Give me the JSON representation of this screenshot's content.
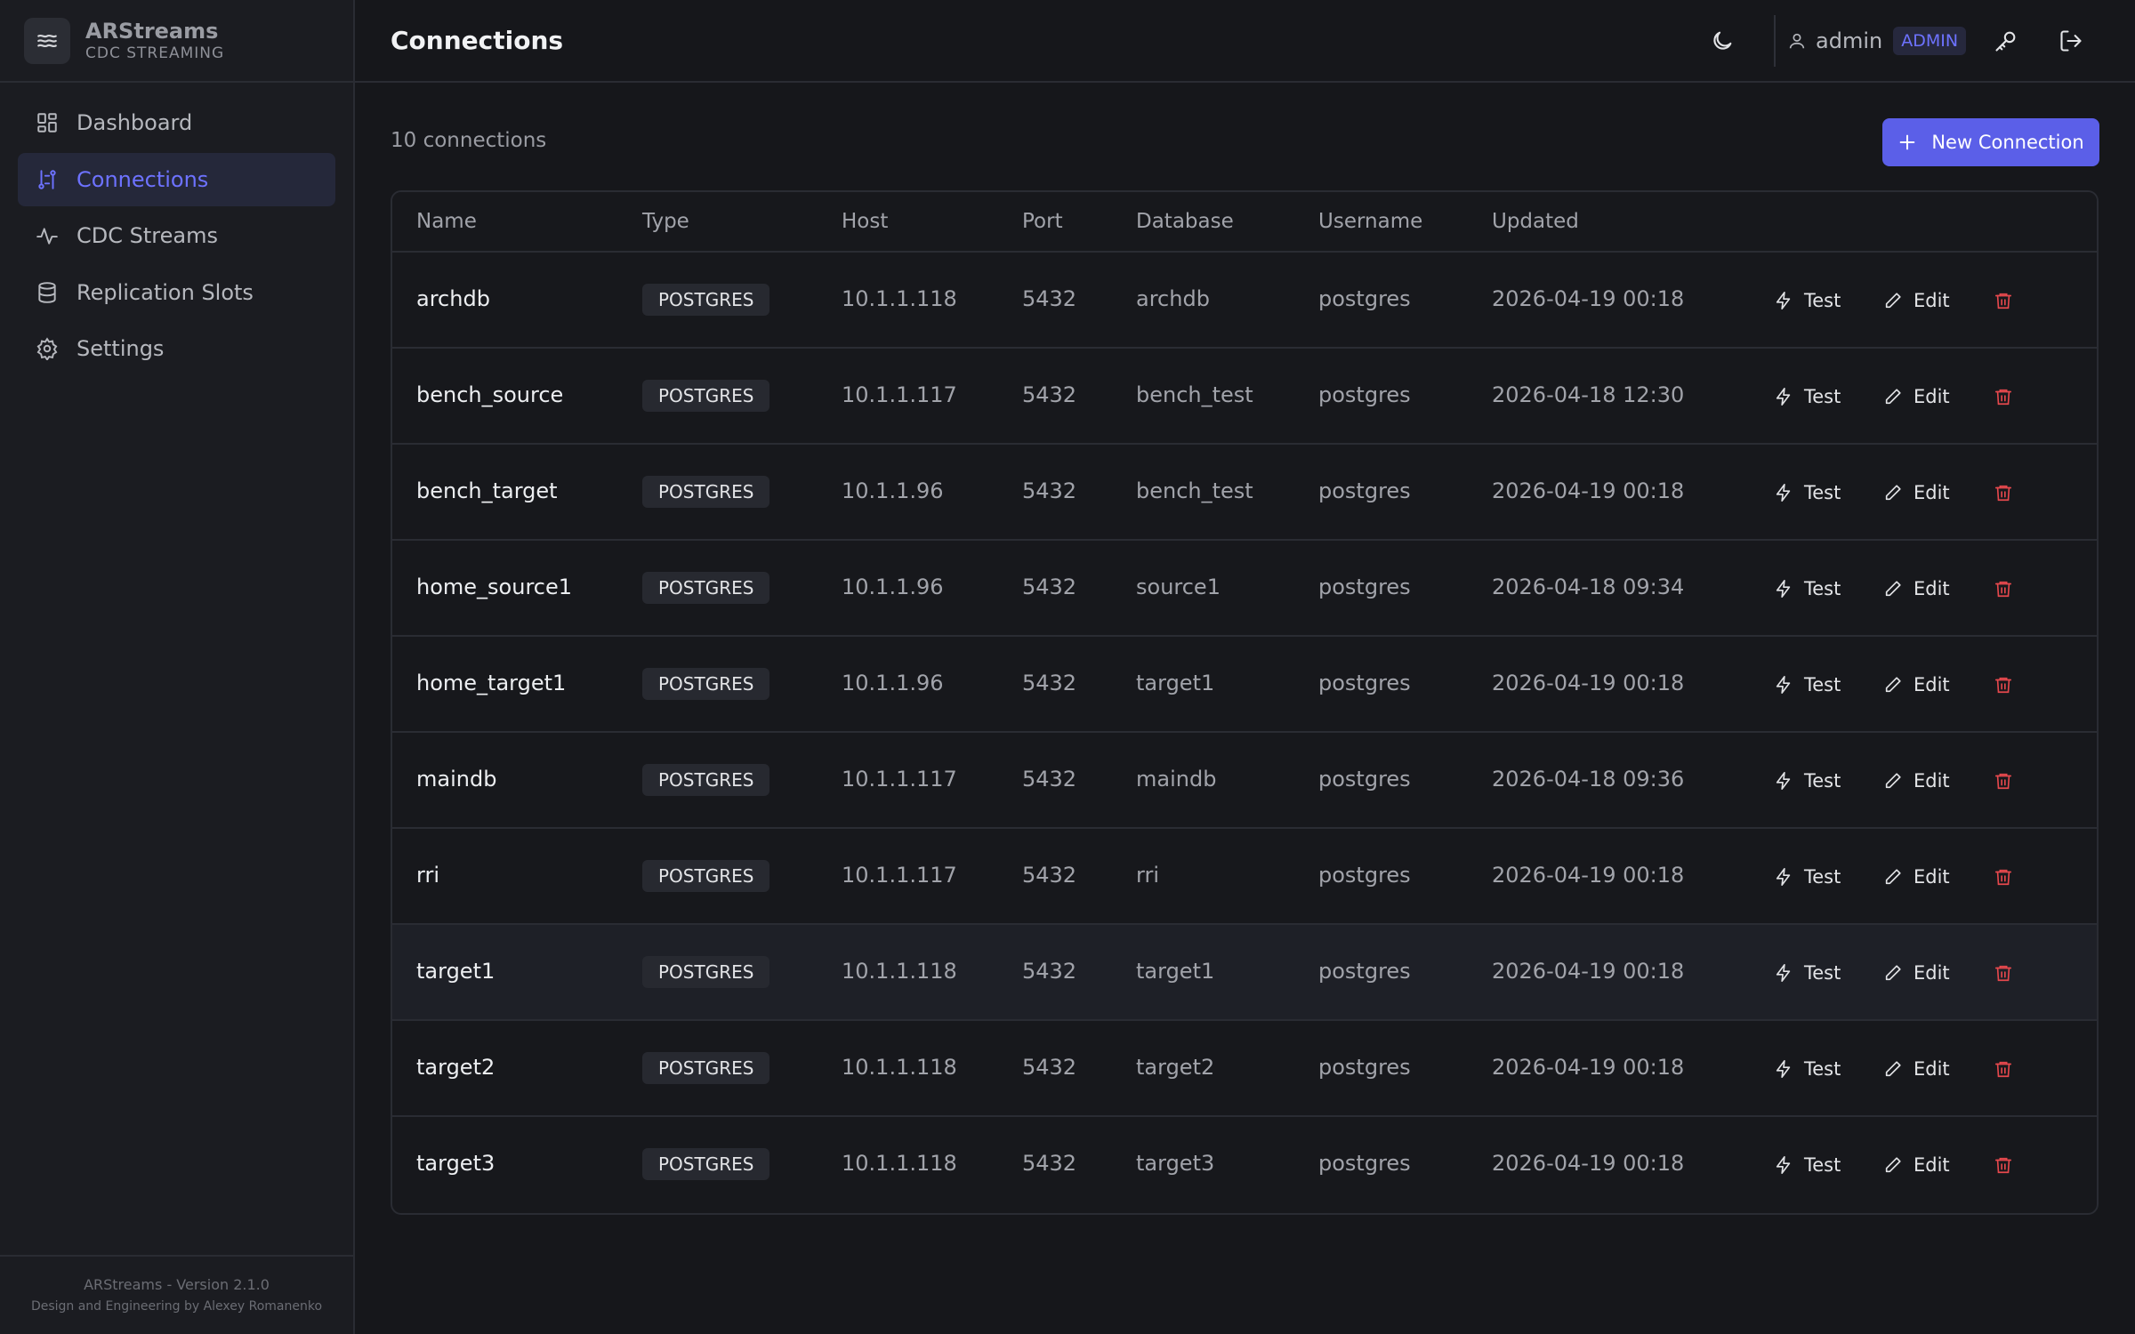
{
  "app": {
    "name": "ARStreams",
    "subtitle": "CDC STREAMING",
    "version_text": "ARStreams - Version 2.1.0",
    "credit_text": "Design and Engineering by Alexey Romanenko"
  },
  "nav": {
    "items": [
      {
        "label": "Dashboard",
        "icon": "grid-icon",
        "active": false
      },
      {
        "label": "Connections",
        "icon": "connections-icon",
        "active": true
      },
      {
        "label": "CDC Streams",
        "icon": "activity-icon",
        "active": false
      },
      {
        "label": "Replication Slots",
        "icon": "database-icon",
        "active": false
      },
      {
        "label": "Settings",
        "icon": "gear-icon",
        "active": false
      }
    ]
  },
  "header": {
    "title": "Connections",
    "user_name": "admin",
    "role": "ADMIN"
  },
  "toolbar": {
    "count_text": "10 connections",
    "new_label": "New Connection"
  },
  "table": {
    "columns": [
      "Name",
      "Type",
      "Host",
      "Port",
      "Database",
      "Username",
      "Updated"
    ],
    "test_label": "Test",
    "edit_label": "Edit",
    "rows": [
      {
        "name": "archdb",
        "type": "POSTGRES",
        "host": "10.1.1.118",
        "port": "5432",
        "database": "archdb",
        "username": "postgres",
        "updated": "2026-04-19 00:18"
      },
      {
        "name": "bench_source",
        "type": "POSTGRES",
        "host": "10.1.1.117",
        "port": "5432",
        "database": "bench_test",
        "username": "postgres",
        "updated": "2026-04-18 12:30"
      },
      {
        "name": "bench_target",
        "type": "POSTGRES",
        "host": "10.1.1.96",
        "port": "5432",
        "database": "bench_test",
        "username": "postgres",
        "updated": "2026-04-19 00:18"
      },
      {
        "name": "home_source1",
        "type": "POSTGRES",
        "host": "10.1.1.96",
        "port": "5432",
        "database": "source1",
        "username": "postgres",
        "updated": "2026-04-18 09:34"
      },
      {
        "name": "home_target1",
        "type": "POSTGRES",
        "host": "10.1.1.96",
        "port": "5432",
        "database": "target1",
        "username": "postgres",
        "updated": "2026-04-19 00:18"
      },
      {
        "name": "maindb",
        "type": "POSTGRES",
        "host": "10.1.1.117",
        "port": "5432",
        "database": "maindb",
        "username": "postgres",
        "updated": "2026-04-18 09:36"
      },
      {
        "name": "rri",
        "type": "POSTGRES",
        "host": "10.1.1.117",
        "port": "5432",
        "database": "rri",
        "username": "postgres",
        "updated": "2026-04-19 00:18"
      },
      {
        "name": "target1",
        "type": "POSTGRES",
        "host": "10.1.1.118",
        "port": "5432",
        "database": "target1",
        "username": "postgres",
        "updated": "2026-04-19 00:18"
      },
      {
        "name": "target2",
        "type": "POSTGRES",
        "host": "10.1.1.118",
        "port": "5432",
        "database": "target2",
        "username": "postgres",
        "updated": "2026-04-19 00:18"
      },
      {
        "name": "target3",
        "type": "POSTGRES",
        "host": "10.1.1.118",
        "port": "5432",
        "database": "target3",
        "username": "postgres",
        "updated": "2026-04-19 00:18"
      }
    ]
  },
  "colors": {
    "accent": "#5b5fe8",
    "active_nav_text": "#6d72ff",
    "delete": "#e5484d",
    "background": "#16171b"
  }
}
